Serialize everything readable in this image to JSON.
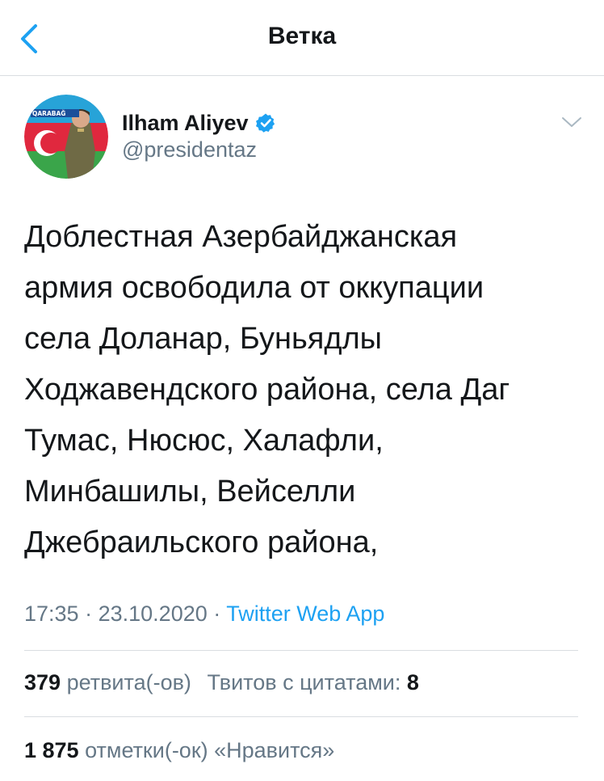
{
  "header": {
    "title": "Ветка",
    "back_icon": "chevron-left-icon"
  },
  "tweet": {
    "author_name": "Ilham Aliyev",
    "author_handle": "@presidentaz",
    "verified_icon": "verified-badge-icon",
    "avatar_label": "QARABAĞ AZƏRBAYCANDIR!",
    "text": "Доблестная Азербайджанская\nармия освободила от оккупации\nсела Доланар, Буньядлы\nХоджавендского района, села Даг\nТумас, Нюсюс, Халафли,\nМинбашилы, Вейселли\nДжебраильского района,",
    "time": "17:35",
    "date": "23.10.2020",
    "separator": "·",
    "source": "Twitter Web App"
  },
  "stats": {
    "retweets_count": "379",
    "retweets_label": "ретвита(-ов)",
    "quotes_label": "Твитов с цитатами:",
    "quotes_count": "8",
    "likes_count": "1 875",
    "likes_label": "отметки(-ок) «Нравится»"
  },
  "colors": {
    "accent": "#1da1f2",
    "secondary_text": "#657786",
    "divider": "#d9dde1"
  }
}
